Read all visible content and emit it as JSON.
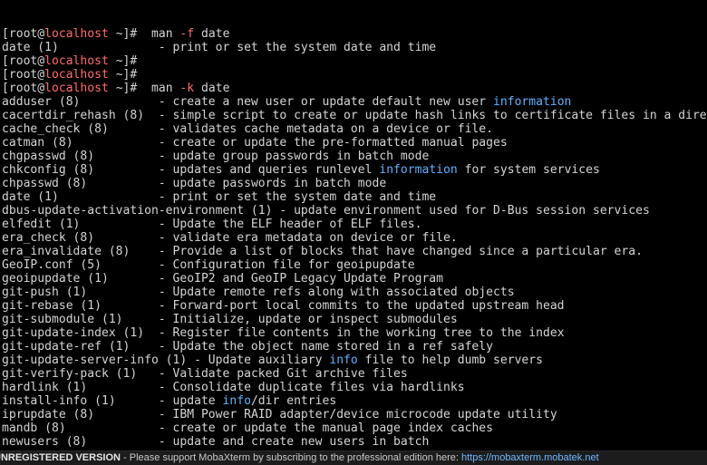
{
  "terminal": {
    "prompt": {
      "open": "[root",
      "at": "@",
      "host": "localhost",
      "close": " ~]#"
    },
    "commands": [
      {
        "cmd": "man",
        "flag": "-f",
        "arg": "date"
      },
      {
        "cmd": "man",
        "flag": "-k",
        "arg": "date"
      }
    ],
    "first_result": {
      "name": "date (1)",
      "desc": "- print or set the system date and time"
    },
    "keyword_results": [
      {
        "name": "adduser (8)",
        "desc": "- create a new user or update default new user ",
        "hl": "information",
        "after": ""
      },
      {
        "name": "cacertdir_rehash (8)",
        "desc": "- simple script to create or update hash links to certificate files in a dire",
        "hl": "",
        "after": ""
      },
      {
        "name": "cache_check (8)",
        "desc": "- validates cache metadata on a device or file.",
        "hl": "",
        "after": ""
      },
      {
        "name": "catman (8)",
        "desc": "- create or update the pre-formatted manual pages",
        "hl": "",
        "after": ""
      },
      {
        "name": "chgpasswd (8)",
        "desc": "- update group passwords in batch mode",
        "hl": "",
        "after": ""
      },
      {
        "name": "chkconfig (8)",
        "desc": "- updates and queries runlevel ",
        "hl": "information",
        "after": " for system services"
      },
      {
        "name": "chpasswd (8)",
        "desc": "- update passwords in batch mode",
        "hl": "",
        "after": ""
      },
      {
        "name": "date (1)",
        "desc": "- print or set the system date and time",
        "hl": "",
        "after": ""
      },
      {
        "name": "dbus-update-activation-environment (1)",
        "desc": "- update environment used for D-Bus session services",
        "hl": "",
        "after": ""
      },
      {
        "name": "elfedit (1)",
        "desc": "- Update the ELF header of ELF files.",
        "hl": "",
        "after": ""
      },
      {
        "name": "era_check (8)",
        "desc": "- validate era metadata on device or file.",
        "hl": "",
        "after": ""
      },
      {
        "name": "era_invalidate (8)",
        "desc": "- Provide a list of blocks that have changed since a particular era.",
        "hl": "",
        "after": ""
      },
      {
        "name": "GeoIP.conf (5)",
        "desc": "- Configuration file for geoipupdate",
        "hl": "",
        "after": ""
      },
      {
        "name": "geoipupdate (1)",
        "desc": "- GeoIP2 and GeoIP Legacy Update Program",
        "hl": "",
        "after": ""
      },
      {
        "name": "git-push (1)",
        "desc": "- Update remote refs along with associated objects",
        "hl": "",
        "after": ""
      },
      {
        "name": "git-rebase (1)",
        "desc": "- Forward-port local commits to the updated upstream head",
        "hl": "",
        "after": ""
      },
      {
        "name": "git-submodule (1)",
        "desc": "- Initialize, update or inspect submodules",
        "hl": "",
        "after": ""
      },
      {
        "name": "git-update-index (1)",
        "desc": "- Register file contents in the working tree to the index",
        "hl": "",
        "after": ""
      },
      {
        "name": "git-update-ref (1)",
        "desc": "- Update the object name stored in a ref safely",
        "hl": "",
        "after": ""
      },
      {
        "name": "git-update-server-info (1)",
        "desc": "- Update auxiliary ",
        "hl": "info",
        "after": " file to help dumb servers"
      },
      {
        "name": "git-verify-pack (1)",
        "desc": "- Validate packed Git archive files",
        "hl": "",
        "after": ""
      },
      {
        "name": "hardlink (1)",
        "desc": "- Consolidate duplicate files via hardlinks",
        "hl": "",
        "after": ""
      },
      {
        "name": "install-info (1)",
        "desc": "- update ",
        "hl": "info",
        "after": "/dir entries"
      },
      {
        "name": "iprupdate (8)",
        "desc": "- IBM Power RAID adapter/device microcode update utility",
        "hl": "",
        "after": ""
      },
      {
        "name": "mandb (8)",
        "desc": "- create or update the manual page index caches",
        "hl": "",
        "after": ""
      },
      {
        "name": "newusers (8)",
        "desc": "- update and create new users in batch",
        "hl": "",
        "after": ""
      }
    ]
  },
  "status_bar": {
    "edition": "UNREGISTERED VERSION",
    "separator": "  -  ",
    "message": "Please support MobaXterm by subscribing to the professional edition here:  ",
    "link": "https://mobaxterm.mobatek.net"
  },
  "colors": {
    "background": "#000000",
    "text": "#d4d4d4",
    "host": "#ff6b6b",
    "highlight": "#5fb0ff",
    "link": "#6fb7ff"
  }
}
